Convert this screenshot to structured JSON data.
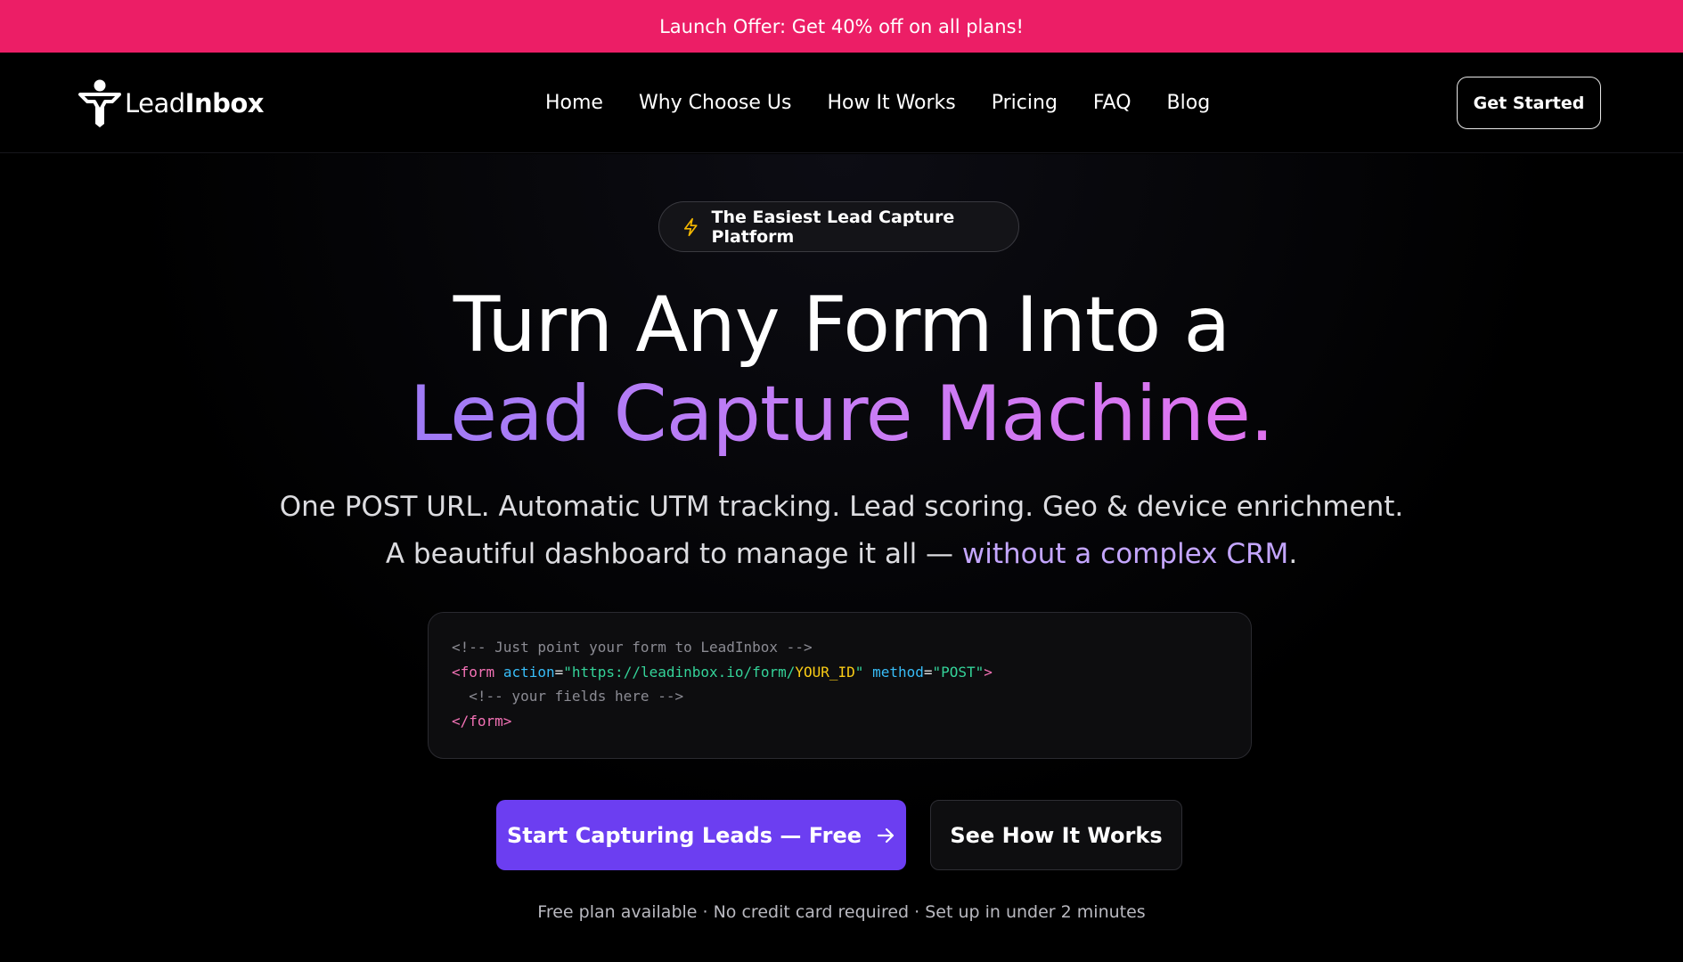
{
  "promo": {
    "text": "Launch Offer: Get 40% off on all plans!",
    "background": "#ec1e66"
  },
  "nav": {
    "logo": {
      "light": "Lead",
      "bold": "Inbox",
      "icon": "funnel-person-icon"
    },
    "links": [
      "Home",
      "Why Choose Us",
      "How It Works",
      "Pricing",
      "FAQ",
      "Blog"
    ],
    "cta": "Get Started"
  },
  "hero": {
    "badge": {
      "icon": "lightning-icon",
      "text": "The Easiest Lead Capture Platform"
    },
    "headline_line1": "Turn Any Form Into a",
    "headline_line2": "Lead Capture Machine.",
    "sub_line1": "One POST URL. Automatic UTM tracking. Lead scoring. Geo & device enrichment.",
    "sub_line2_plain": "A beautiful dashboard to manage it all — ",
    "sub_line2_highlight": "without a complex CRM",
    "sub_line2_end": ".",
    "code": {
      "comment1": "<!-- Just point your form to LeadInbox -->",
      "open_tag": "<form",
      "attr_action": "action",
      "eq": "=",
      "quote": "\"",
      "url": "https://leadinbox.io/form/",
      "url_var": "YOUR_ID",
      "attr_method": "method",
      "method_val": "\"POST\"",
      "close_bracket": ">",
      "comment2": "  <!-- your fields here -->",
      "close_tag": "</form>"
    },
    "primary_button": "Start Capturing Leads — Free",
    "secondary_button": "See How It Works",
    "fineprint": "Free plan available · No credit card required · Set up in under 2 minutes"
  },
  "colors": {
    "accent": "#6c3ef1",
    "gradient_start": "#9f7bf6",
    "gradient_end": "#e073ef",
    "highlight": "#c4a6ff"
  }
}
